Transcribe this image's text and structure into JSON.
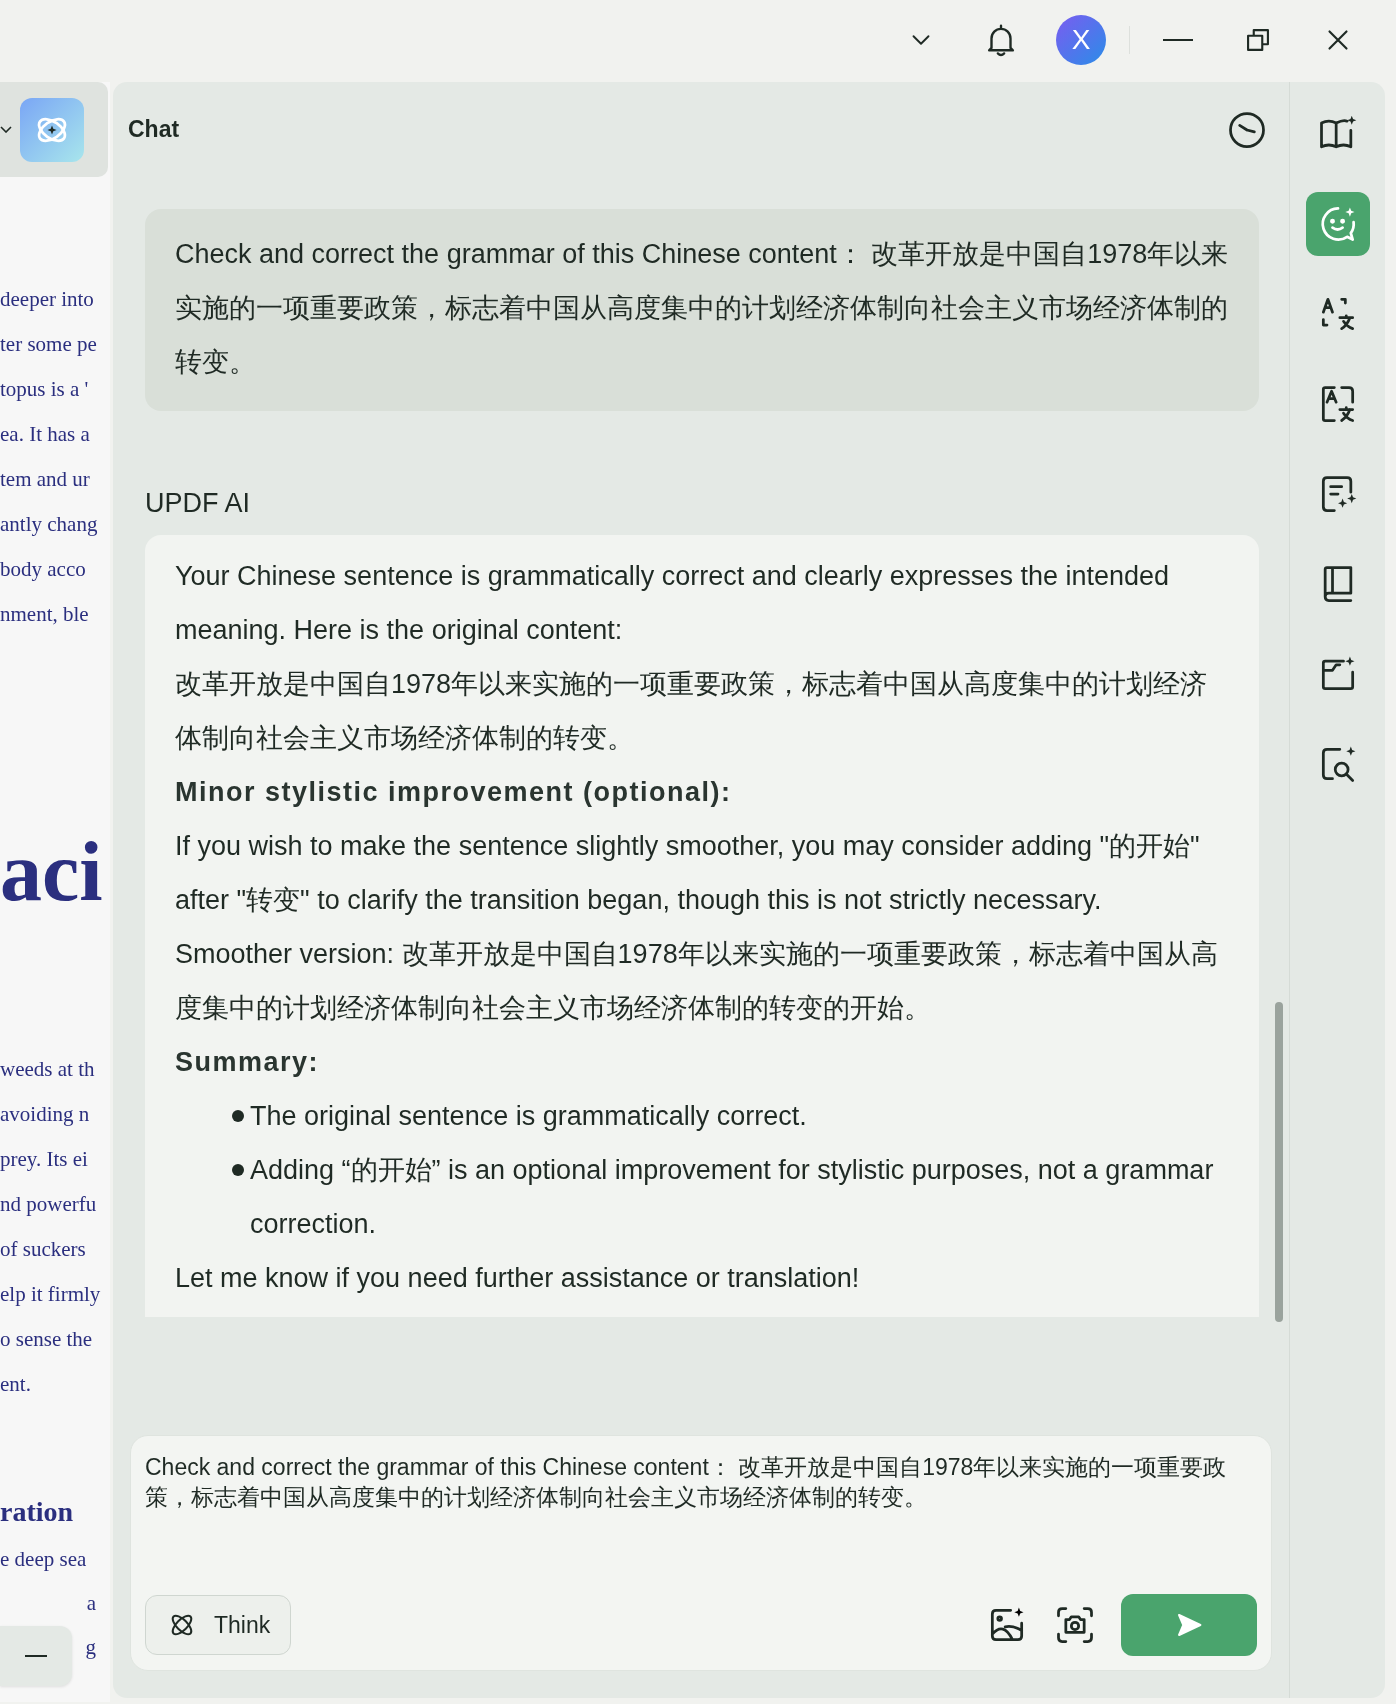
{
  "title_bar": {
    "avatar_letter": "X"
  },
  "document_strip": {
    "blocks": [
      {
        "kind": "paragraph",
        "lines": [
          "deeper into",
          "ter some pe",
          "topus is a '",
          "ea. It has a",
          "tem and ur",
          "antly chang",
          " body acco",
          "nment, ble"
        ]
      },
      {
        "kind": "display",
        "lines": [
          "aci"
        ]
      },
      {
        "kind": "paragraph",
        "lines": [
          "weeds at th",
          " avoiding n",
          " prey. Its ei",
          "nd powerfu",
          " of suckers",
          "elp it firmly",
          "o sense the",
          "ent."
        ]
      },
      {
        "kind": "heading",
        "lines": [
          "ration"
        ]
      },
      {
        "kind": "covered",
        "lines": [
          "e deep sea",
          "a",
          "g"
        ]
      }
    ]
  },
  "chat": {
    "title": "Chat",
    "user_message": "Check and correct the grammar of this Chinese content：  改革开放是中国自1978年以来实施的一项重要政策，标志着中国从高度集中的计划经济体制向社会主义市场经济体制的转变。",
    "assistant_name": "UPDF AI",
    "response": [
      {
        "kind": "text",
        "text": "Your Chinese sentence is grammatically correct and clearly expresses the intended meaning. Here is the original content:"
      },
      {
        "kind": "text",
        "text": "改革开放是中国自1978年以来实施的一项重要政策，标志着中国从高度集中的计划经济体制向社会主义市场经济体制的转变。"
      },
      {
        "kind": "heading",
        "text": "Minor stylistic improvement (optional):"
      },
      {
        "kind": "text",
        "text": "If you wish to make the sentence slightly smoother, you may consider adding \"的开始\" after \"转变\" to clarify the transition began, though this is not strictly necessary."
      },
      {
        "kind": "text",
        "text": "Smoother version: 改革开放是中国自1978年以来实施的一项重要政策，标志着中国从高度集中的计划经济体制向社会主义市场经济体制的转变的开始。"
      },
      {
        "kind": "heading",
        "text": "Summary:"
      },
      {
        "kind": "bullet",
        "text": "The original sentence is grammatically correct."
      },
      {
        "kind": "bullet",
        "text": "Adding “的开始” is an optional improvement for stylistic purposes, not a grammar correction."
      },
      {
        "kind": "text",
        "text": "Let me know if you need further assistance or translation!"
      }
    ]
  },
  "input": {
    "value": "Check and correct the grammar of this Chinese content：  改革开放是中国自1978年以来实施的一项重要政策，标志着中国从高度集中的计划经济体制向社会主义市场经济体制的转变。",
    "think_label": "Think"
  },
  "sidebar": {
    "tools": [
      {
        "selected": false
      },
      {
        "selected": true
      },
      {
        "selected": false
      },
      {
        "selected": false
      },
      {
        "selected": false
      },
      {
        "selected": false
      },
      {
        "selected": false
      },
      {
        "selected": false
      }
    ]
  }
}
